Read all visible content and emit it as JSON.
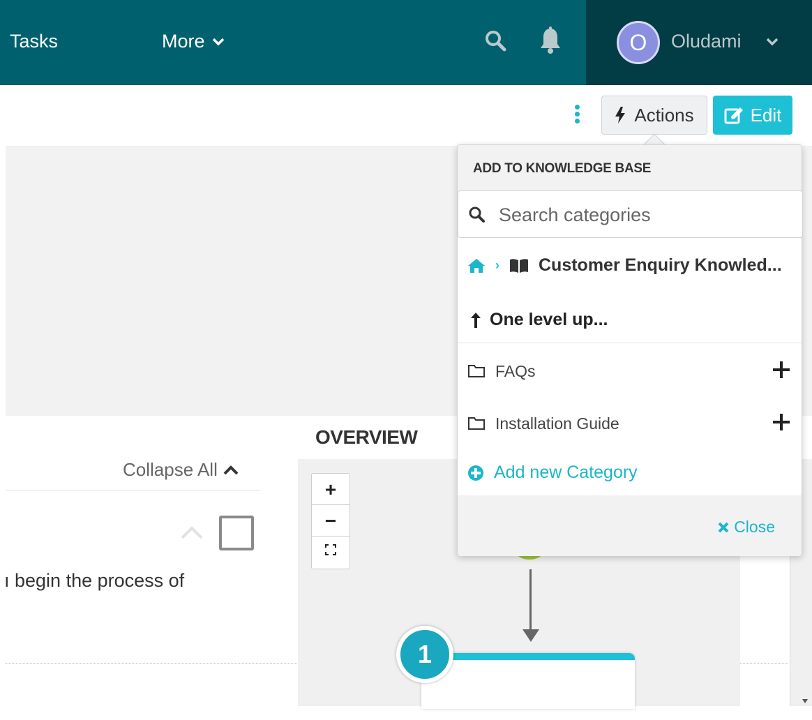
{
  "nav": {
    "tasks_label": "Tasks",
    "more_label": "More",
    "search_icon": "search-icon",
    "notification_icon": "bell-icon",
    "user": {
      "avatar_initial": "O",
      "name": "Oludami",
      "avatar_color": "#8a8fe0"
    },
    "colors": {
      "nav_bg": "#00606d",
      "user_bg": "#023c45"
    }
  },
  "toolbar": {
    "actions_label": "Actions",
    "edit_label": "Edit",
    "accent": "#1ec0d6"
  },
  "left_panel": {
    "collapse_all_label": "Collapse All",
    "step_text": "ı begin the process of"
  },
  "overview": {
    "title": "OVERVIEW",
    "zoom_in": "+",
    "zoom_out": "−",
    "step_number": "1"
  },
  "kb_dropdown": {
    "header": "ADD TO KNOWLEDGE BASE",
    "search_placeholder": "Search categories",
    "breadcrumb_label": "Customer Enquiry Knowled...",
    "level_up_label": "One level up...",
    "categories": [
      {
        "label": "FAQs"
      },
      {
        "label": "Installation Guide"
      }
    ],
    "add_category_label": "Add new Category",
    "close_label": "Close"
  }
}
